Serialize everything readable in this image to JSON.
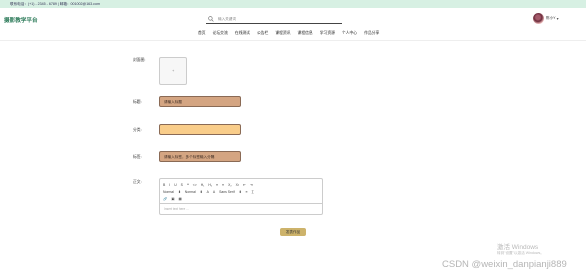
{
  "topbar": {
    "contact": "联系电话：(+1) - 2345 - 6789 | 邮箱：001002@163.com"
  },
  "header": {
    "logo": "摄影教学平台",
    "search_placeholder": "输入关键词",
    "username": "陈小Y",
    "nav": [
      "首页",
      "论坛交流",
      "在线测试",
      "公告栏",
      "课程资讯",
      "课程信息",
      "学习资源",
      "个人中心",
      "作品分享"
    ]
  },
  "form": {
    "cover_label": "封面图:",
    "upload_symbol": "+",
    "title_label": "标题:",
    "title_placeholder": "请输入标题",
    "category_label": "分类:",
    "category_value": "",
    "tags_label": "标签:",
    "tags_placeholder": "请输入标签，多个标签输入分隔",
    "content_label": "正文:",
    "editor": {
      "toolbar_row1": [
        "B",
        "I",
        "U",
        "S",
        "❝",
        "<>",
        "H₁",
        "H₂",
        "≡",
        "≡",
        "X₂",
        "X²",
        "⇤",
        "⇥"
      ],
      "toolbar_row2": [
        "Normal",
        "⬍",
        "Normal",
        "⬍",
        "A",
        "A",
        "Sans Serif",
        "⬍",
        "≡",
        "T̲"
      ],
      "toolbar_row3": [
        "🔗",
        "▣",
        "▦"
      ],
      "placeholder": "Insert text here ..."
    },
    "submit_label": "发表作品"
  },
  "watermark": {
    "title": "激活 Windows",
    "subtitle": "转到\"设置\"以激活 Windows。",
    "csdn": "CSDN @weixin_danpianji889"
  }
}
